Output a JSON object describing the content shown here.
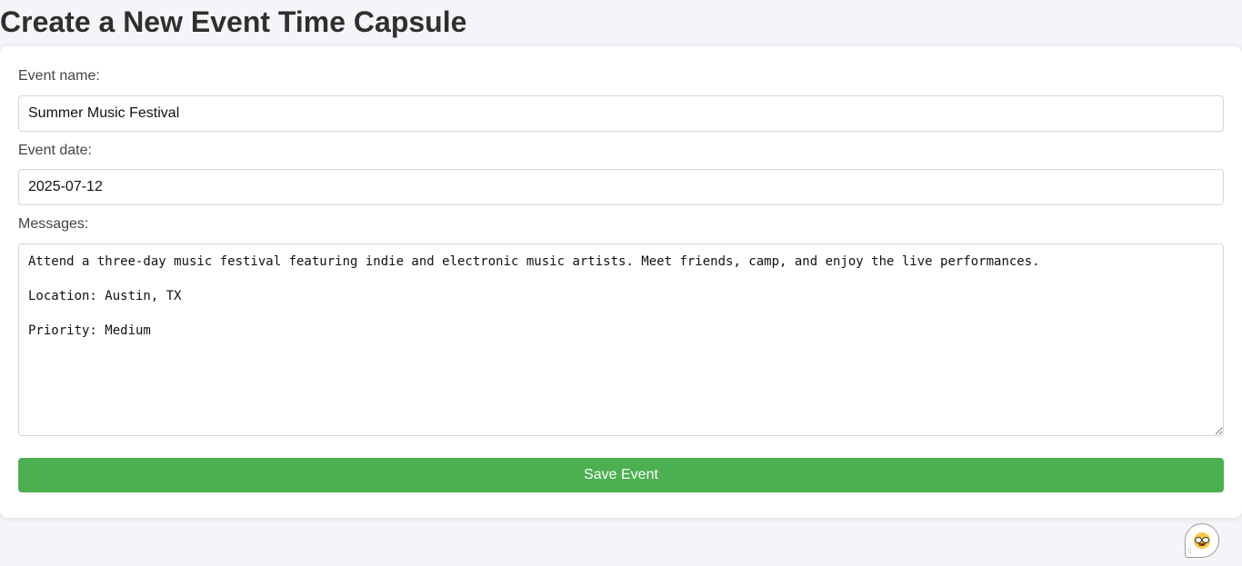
{
  "page": {
    "title": "Create a New Event Time Capsule"
  },
  "form": {
    "event_name_label": "Event name:",
    "event_name_value": "Summer Music Festival",
    "event_date_label": "Event date:",
    "event_date_value": "2025-07-12",
    "messages_label": "Messages:",
    "messages_value": "Attend a three-day music festival featuring indie and electronic music artists. Meet friends, camp, and enjoy the live performances.\n\nLocation: Austin, TX\n\nPriority: Medium",
    "save_label": "Save Event"
  },
  "colors": {
    "save_button": "#4caf50",
    "background": "#f4f5f8"
  },
  "icons": {
    "helper": "nerd-face-icon"
  }
}
